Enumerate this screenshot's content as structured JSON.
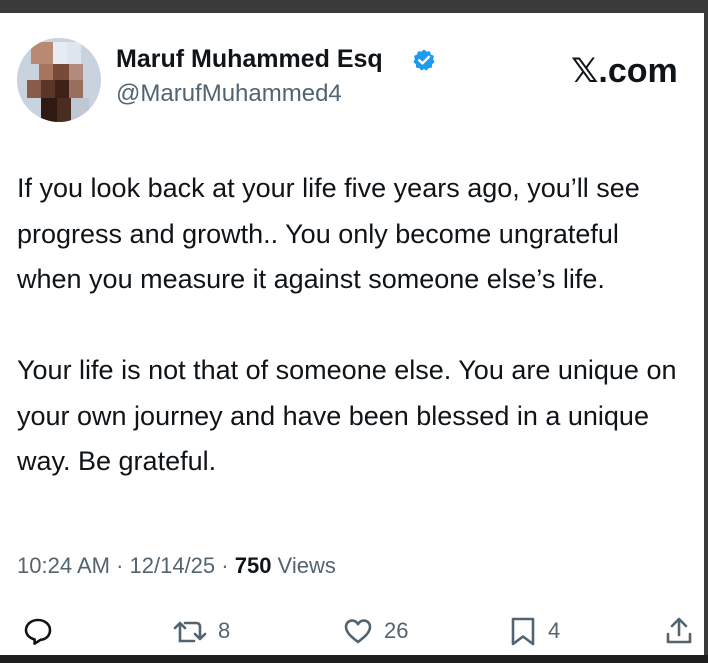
{
  "author": {
    "display_name": "Maruf Muhammed Esq",
    "handle": "@MarufMuhammed4",
    "verified": true,
    "avatar": "profile-photo-pixelated"
  },
  "brand": {
    "text": ".com",
    "logo": "x-logo"
  },
  "post": {
    "paragraphs": [
      "If you look back at your life five years ago, you’ll see progress and growth.. You only become ungrateful when you measure it against someone else’s life.",
      "Your life is not that of someone else. You are unique on your own journey and have been blessed in a unique way. Be grateful."
    ]
  },
  "meta": {
    "time": "10:24 AM",
    "separator": " · ",
    "date": "12/14/25",
    "views_count": "750",
    "views_label": " Views"
  },
  "actions": {
    "reply": {
      "icon": "reply-icon"
    },
    "repost": {
      "icon": "repost-icon",
      "count": "8"
    },
    "like": {
      "icon": "heart-icon",
      "count": "26"
    },
    "bookmark": {
      "icon": "bookmark-icon",
      "count": "4"
    },
    "share": {
      "icon": "share-icon"
    }
  },
  "colors": {
    "text_primary": "#0f1419",
    "text_secondary": "#536471",
    "verified_blue": "#1d9bf0",
    "frame": "#3a3a3a"
  }
}
